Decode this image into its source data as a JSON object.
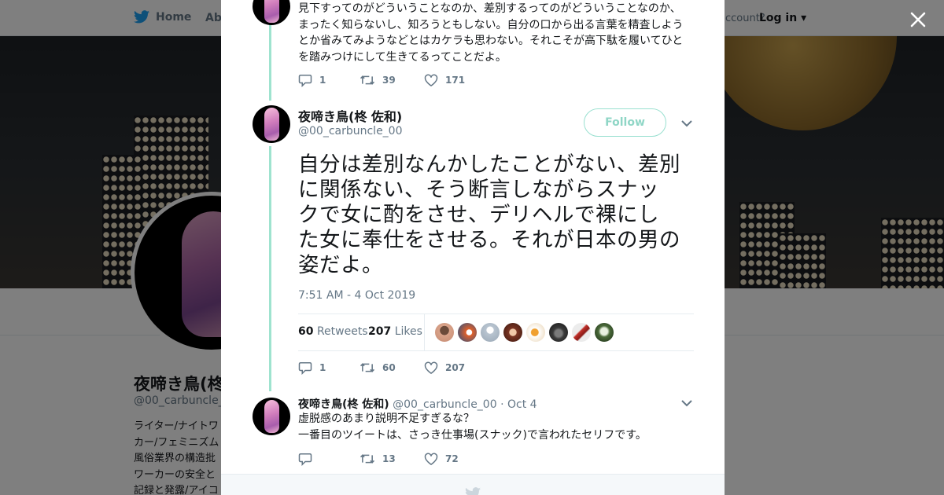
{
  "nav": {
    "home_label": "Home",
    "about_label": "Abo",
    "account_text": "ccount?",
    "login_label": "Log in"
  },
  "background_profile": {
    "name": "夜啼き鳥(柊",
    "handle": "@00_carbuncle_0",
    "bio_lines": [
      "ライター/ナイトワ",
      "カー/フェミニズム",
      "風俗業界の構造批",
      "ワーカーの安全と",
      "記録と発露/アイコ"
    ]
  },
  "modal": {
    "tweet_prev": {
      "lines": [
        "見下すってのがどういうことなのか、差別するってのがどういうことなのか、",
        "まったく知らないし、知ろうともしない。自分の口から出る言葉を精査しよう",
        "とか省みてみようなどとはカケラも思わない。それこそが高下駄を履いてひと",
        "を踏みつけにして生きてるってことだよ。"
      ],
      "replies": "1",
      "retweets": "39",
      "likes": "171"
    },
    "tweet_main": {
      "name": "夜啼き鳥(柊 佐和)",
      "handle": "@00_carbuncle_00",
      "follow_label": "Follow",
      "lines": [
        "自分は差別なんかしたことがない、差別",
        "に関係ない、そう断言しながらスナッ",
        "クで女に酌をさせ、デリヘルで裸にし",
        "た女に奉仕をさせる。それが日本の男の",
        "姿だよ。"
      ],
      "timestamp": "7:51 AM - 4 Oct 2019",
      "retweet_count": "60",
      "retweet_word": "Retweets",
      "like_count": "207",
      "like_word": "Likes",
      "replies": "1",
      "retweets": "60",
      "likes": "207"
    },
    "tweet_reply": {
      "name": "夜啼き鳥(柊 佐和)",
      "handle": "@00_carbuncle_00",
      "date": "· Oct 4",
      "lines": [
        "虚脱感のあまり説明不足すぎるな？",
        "一番目のツイートは、さっき仕事場(スナック)で言われたセリフです。"
      ],
      "replies": "",
      "retweets": "13",
      "likes": "72"
    }
  },
  "colors": {
    "thread_line": "#9fe3cf",
    "follow_border": "#99e0d0",
    "muted_text": "#657786",
    "main_text": "#14171a"
  },
  "icons": [
    "twitter-bird-icon",
    "close-icon",
    "reply-icon",
    "retweet-icon",
    "heart-icon",
    "chevron-down-icon"
  ]
}
